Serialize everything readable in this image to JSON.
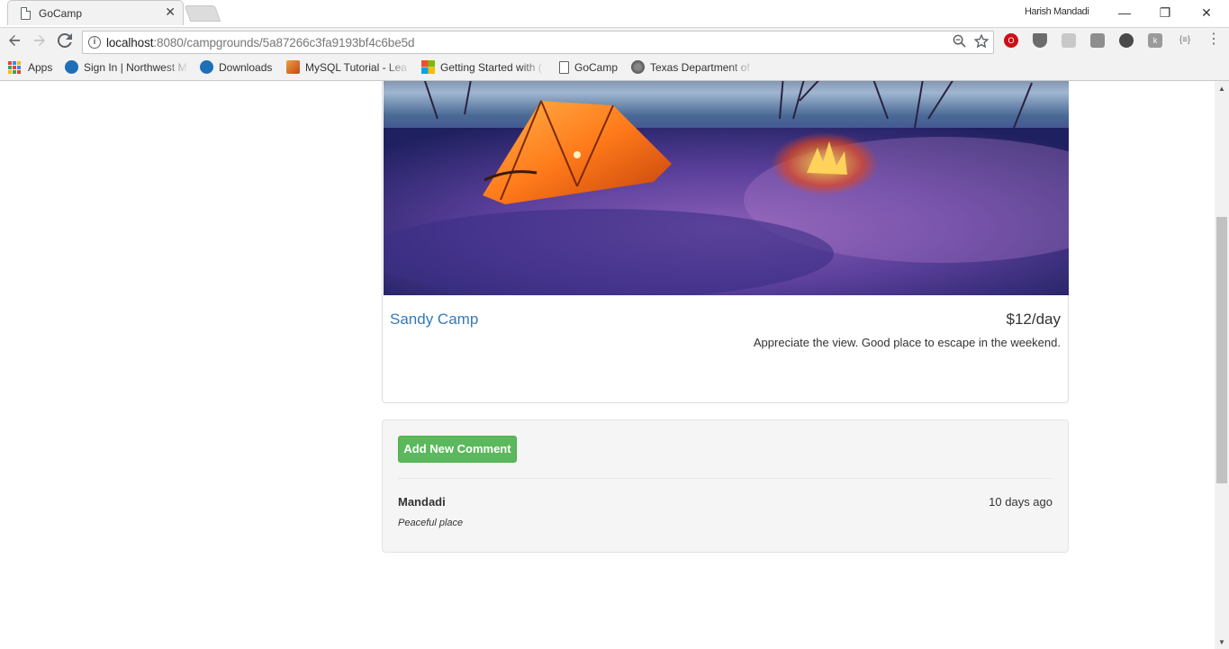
{
  "browser": {
    "tab_title": "GoCamp",
    "profile_name": "Harish Mandadi",
    "url_host": "localhost",
    "url_path": ":8080/campgrounds/5a87266c3fa9193bf4c6be5d",
    "window_controls": {
      "minimize": "—",
      "restore": "❐",
      "close": "✕"
    },
    "bookmarks": [
      {
        "label": "Apps",
        "icon": "apps-grid-icon"
      },
      {
        "label": "Sign In | Northwest M",
        "icon": "oth-icon"
      },
      {
        "label": "Downloads",
        "icon": "oth-icon"
      },
      {
        "label": "MySQL Tutorial - Lea",
        "icon": "mysql-icon"
      },
      {
        "label": "Getting Started with (",
        "icon": "microsoft-icon"
      },
      {
        "label": "GoCamp",
        "icon": "page-icon"
      },
      {
        "label": "Texas Department of",
        "icon": "seal-icon"
      }
    ],
    "extension_colors": [
      "#cc0f16",
      "#6b6b6b",
      "#b8b8b8",
      "#8e8e8e",
      "#4a4a4a",
      "#9a9a9a",
      "#8a8a8a"
    ]
  },
  "campground": {
    "name": "Sandy Camp",
    "price": "$12/day",
    "description": "Appreciate the view. Good place to escape in the weekend."
  },
  "comments": {
    "add_button_label": "Add New Comment",
    "items": [
      {
        "author": "Mandadi",
        "date": "10 days ago",
        "text": "Peaceful place"
      }
    ]
  },
  "colors": {
    "link": "#337ab7",
    "success": "#5cb85c",
    "well_bg": "#f5f5f5"
  }
}
